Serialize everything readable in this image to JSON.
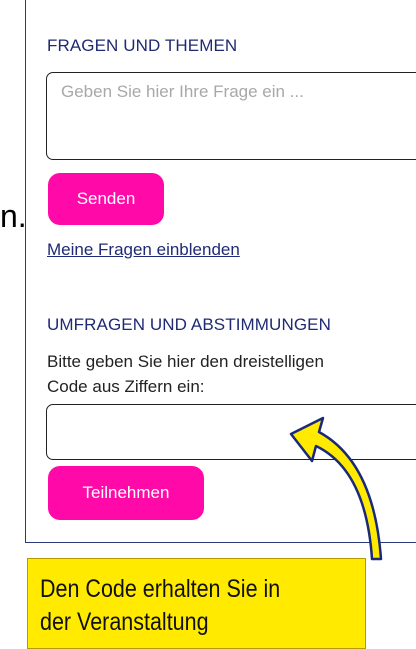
{
  "cutoff_char": "n.",
  "questions": {
    "title": "FRAGEN UND THEMEN",
    "input_placeholder": "Geben Sie hier Ihre Frage ein ...",
    "send_label": "Senden",
    "my_questions_link": "Meine Fragen einblenden"
  },
  "polls": {
    "title": "UMFRAGEN UND ABSTIMMUNGEN",
    "instruction_line1": "Bitte geben Sie hier den dreistelligen",
    "instruction_line2": "Code aus Ziffern ein:",
    "code_value": "",
    "join_label": "Teilnehmen"
  },
  "callout": {
    "line1": "Den Code erhalten Sie in",
    "line2": "der Veranstaltung"
  },
  "colors": {
    "accent_pink": "#ff0aa8",
    "heading_blue": "#1f2a73",
    "callout_yellow": "#ffea00",
    "arrow_blue": "#1a2a78"
  },
  "icons": {
    "arrow": "curved-arrow-icon"
  }
}
